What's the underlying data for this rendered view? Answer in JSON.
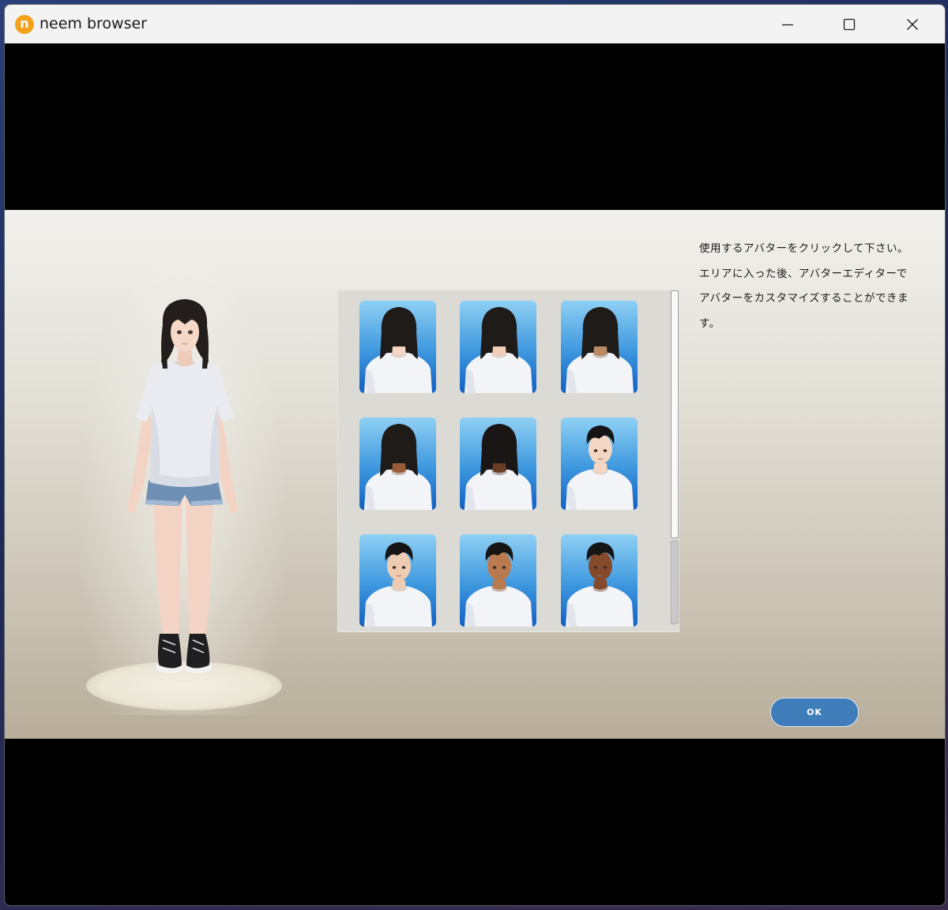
{
  "window": {
    "app_name": "neem browser",
    "logo_letter": "n",
    "controls": {
      "minimize": "minimize-icon",
      "maximize": "maximize-icon",
      "close": "close-icon"
    }
  },
  "instructions": {
    "lines": [
      "使用するアバターをクリックして下さい。",
      "エリアに入った後、アバターエディターで",
      "アバターをカスタマイズすることができま",
      "す。"
    ]
  },
  "avatar_grid": {
    "items": [
      {
        "kind": "female",
        "skin": "#f4d4c2",
        "hair": "#1f1b19",
        "selected": true
      },
      {
        "kind": "female",
        "skin": "#f1cdb8",
        "hair": "#1f1b19"
      },
      {
        "kind": "female",
        "skin": "#b98a62",
        "hair": "#1f1b19"
      },
      {
        "kind": "female",
        "skin": "#9a5b3a",
        "hair": "#1f1b19"
      },
      {
        "kind": "female",
        "skin": "#6a3d26",
        "hair": "#1a1615"
      },
      {
        "kind": "male",
        "skin": "#f4d6c4",
        "hair": "#151515"
      },
      {
        "kind": "male",
        "skin": "#edccb3",
        "hair": "#151515"
      },
      {
        "kind": "male",
        "skin": "#b87a4e",
        "hair": "#151515"
      },
      {
        "kind": "male",
        "skin": "#844a2b",
        "hair": "#151515"
      }
    ]
  },
  "ok_button": {
    "label": "OK"
  },
  "colors": {
    "accent": "#3e7db9",
    "thumb_gradient_top": "#8fd0f4",
    "thumb_gradient_bottom": "#1260c3",
    "logo": "#f2a21b"
  }
}
